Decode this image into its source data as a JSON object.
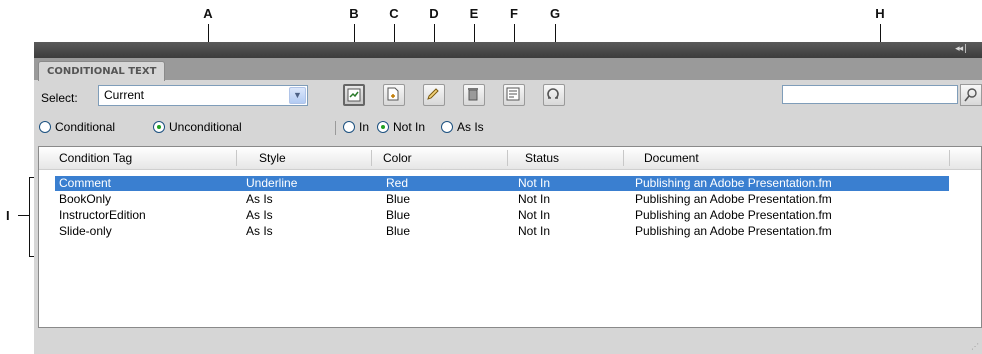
{
  "callouts": [
    "A",
    "B",
    "C",
    "D",
    "E",
    "F",
    "G",
    "H",
    "I"
  ],
  "panel": {
    "tab_label": "CONDITIONAL TEXT",
    "select_label": "Select:",
    "select_value": "Current",
    "search_value": "",
    "filter_radios": [
      {
        "label": "Conditional",
        "checked": false
      },
      {
        "label": "Unconditional",
        "checked": true
      }
    ],
    "in_radios": [
      {
        "label": "In",
        "checked": false
      },
      {
        "label": "Not In",
        "checked": true
      },
      {
        "label": "As Is",
        "checked": false
      }
    ],
    "toolbar_icons": [
      "apply-condition-icon",
      "new-condition-icon",
      "edit-condition-icon",
      "delete-condition-icon",
      "show-hide-icon",
      "refresh-icon"
    ]
  },
  "table": {
    "columns": [
      "Condition Tag",
      "Style",
      "Color",
      "Status",
      "Document"
    ],
    "rows": [
      {
        "tag": "Comment",
        "style": "Underline",
        "color": "Red",
        "status": "Not In",
        "document": "Publishing an Adobe Presentation.fm",
        "selected": true
      },
      {
        "tag": "BookOnly",
        "style": "As Is",
        "color": "Blue",
        "status": "Not In",
        "document": "Publishing an Adobe Presentation.fm",
        "selected": false
      },
      {
        "tag": "InstructorEdition",
        "style": "As Is",
        "color": "Blue",
        "status": "Not In",
        "document": "Publishing an Adobe Presentation.fm",
        "selected": false
      },
      {
        "tag": "Slide-only",
        "style": "As Is",
        "color": "Blue",
        "status": "Not In",
        "document": "Publishing an Adobe Presentation.fm",
        "selected": false
      }
    ]
  },
  "colors": {
    "selection": "#3a7fd0",
    "titlebar": "#4a4a4a",
    "panel": "#d6d6d6",
    "radio_dot": "#21a121"
  }
}
